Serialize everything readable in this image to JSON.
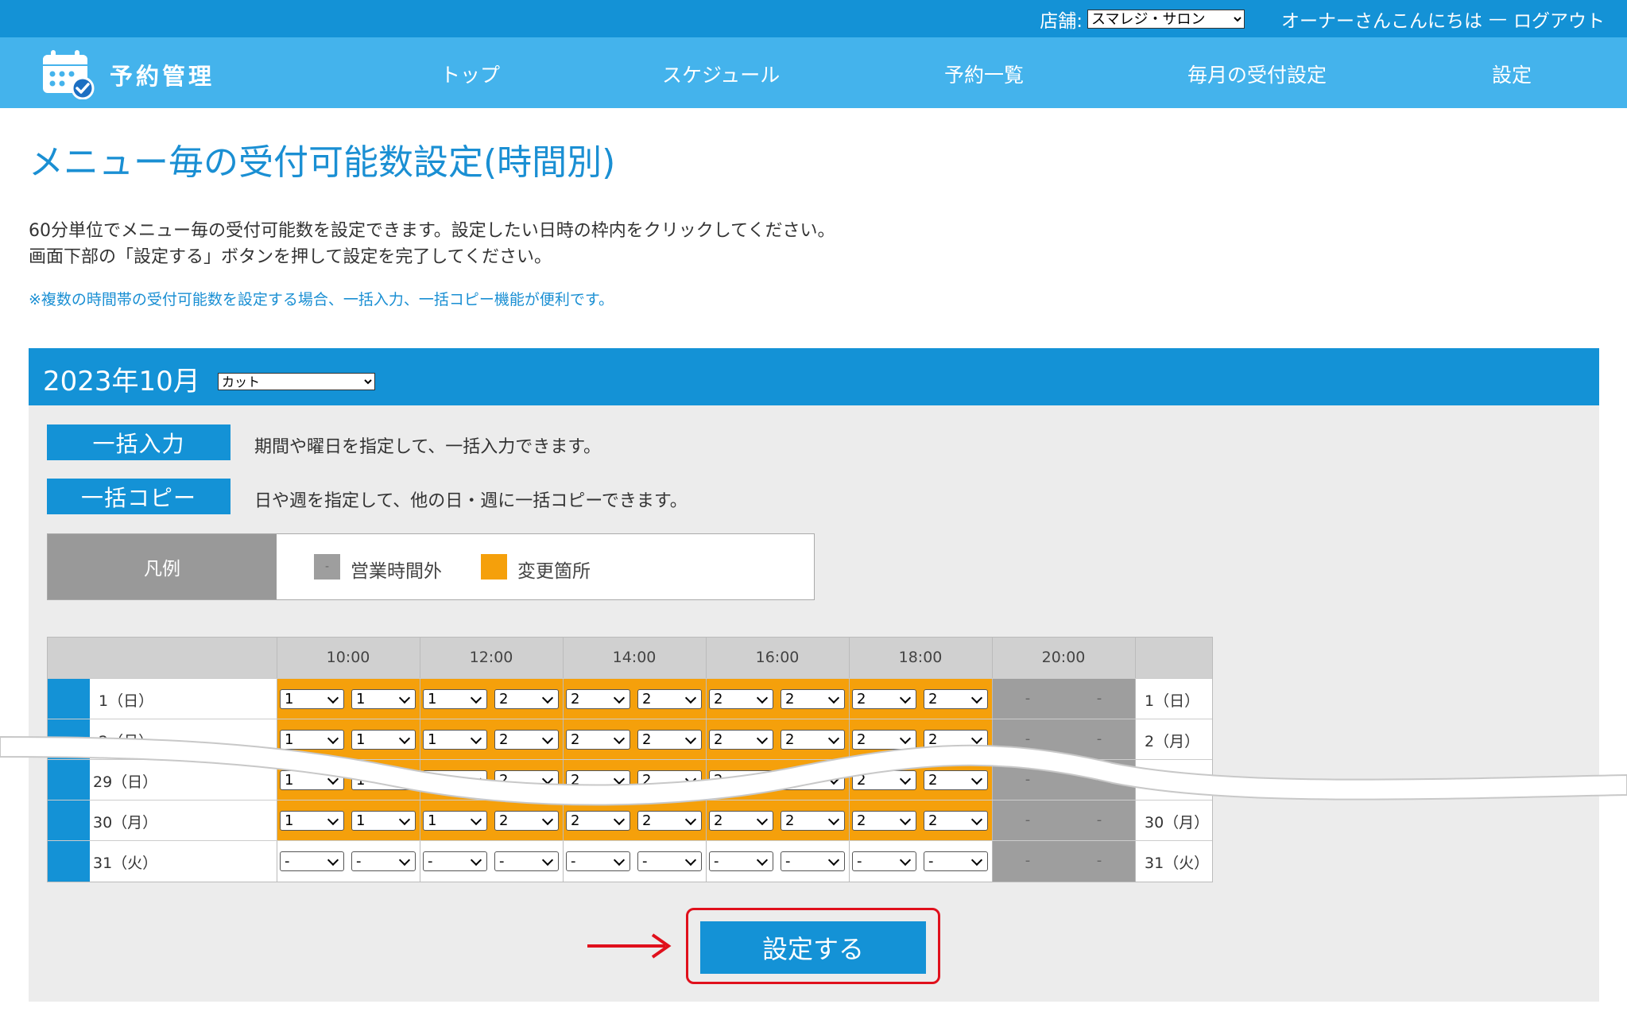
{
  "topbar": {
    "store_label": "店舗:",
    "store_value": "スマレジ・サロン",
    "greeting": "オーナーさんこんにちは",
    "separator": "—",
    "logout": "ログアウト"
  },
  "nav": {
    "logo_text": "予約管理",
    "items": [
      "トップ",
      "スケジュール",
      "予約一覧",
      "毎月の受付設定",
      "設定"
    ]
  },
  "page": {
    "title": "メニュー毎の受付可能数設定(時間別)",
    "desc1": "60分単位でメニュー毎の受付可能数を設定できます。設定したい日時の枠内をクリックしてください。",
    "desc2": "画面下部の「設定する」ボタンを押して設定を完了してください。",
    "note": "※複数の時間帯の受付可能数を設定する場合、一括入力、一括コピー機能が便利です。"
  },
  "panel": {
    "month": "2023年10月",
    "menu_value": "カット",
    "bulk_input_label": "一括入力",
    "bulk_input_desc": "期間や曜日を指定して、一括入力できます。",
    "bulk_copy_label": "一括コピー",
    "bulk_copy_desc": "日や週を指定して、他の日・週に一括コピーできます。"
  },
  "legend": {
    "title": "凡例",
    "closed_symbol": "-",
    "closed_label": "営業時間外",
    "changed_label": "変更箇所",
    "closed_color": "#9e9e9e",
    "changed_color": "#f5a00b"
  },
  "schedule": {
    "hours": [
      "10:00",
      "12:00",
      "14:00",
      "16:00",
      "18:00",
      "20:00"
    ],
    "rows": [
      {
        "day": "1（日）",
        "values": [
          "1",
          "1",
          "1",
          "2",
          "2",
          "2",
          "2",
          "2",
          "2",
          "2"
        ],
        "closed": [
          "-",
          "-"
        ]
      },
      {
        "day": "2（月）",
        "values": [
          "1",
          "1",
          "1",
          "2",
          "2",
          "2",
          "2",
          "2",
          "2",
          "2"
        ],
        "closed": [
          "-",
          "-"
        ]
      },
      {
        "day": "29（日）",
        "values": [
          "1",
          "1",
          "1",
          "2",
          "2",
          "2",
          "2",
          "2",
          "2",
          "2"
        ],
        "closed": [
          "-",
          "-"
        ]
      },
      {
        "day": "30（月）",
        "values": [
          "1",
          "1",
          "1",
          "2",
          "2",
          "2",
          "2",
          "2",
          "2",
          "2"
        ],
        "closed": [
          "-",
          "-"
        ]
      },
      {
        "day": "31（火）",
        "values": [
          "-",
          "-",
          "-",
          "-",
          "-",
          "-",
          "-",
          "-",
          "-",
          "-"
        ],
        "closed": [
          "-",
          "-"
        ]
      }
    ]
  },
  "submit_label": "設定する",
  "colors": {
    "primary": "#1492d6",
    "nav": "#44b3ec",
    "highlight": "#e0101c"
  }
}
